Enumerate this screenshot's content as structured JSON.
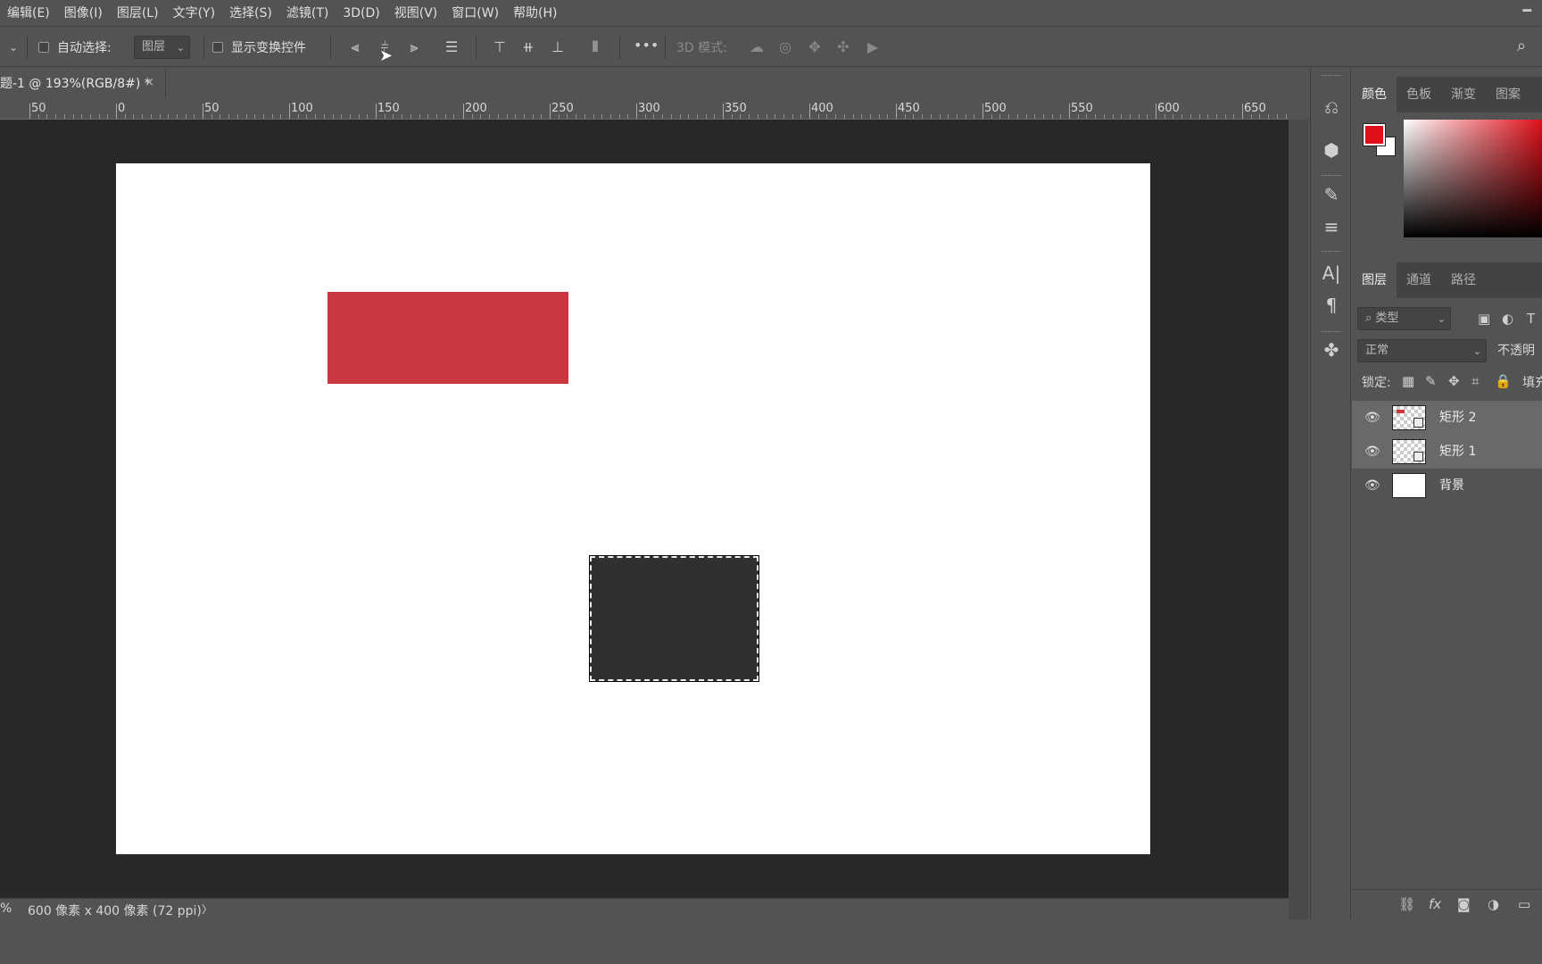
{
  "menubar": {
    "items": [
      "编辑(E)",
      "图像(I)",
      "图层(L)",
      "文字(Y)",
      "选择(S)",
      "滤镜(T)",
      "3D(D)",
      "视图(V)",
      "窗口(W)",
      "帮助(H)"
    ],
    "minimize_icon": "minimize-icon"
  },
  "options": {
    "auto_select_label": "自动选择:",
    "auto_select_checked": false,
    "auto_select_target": "图层",
    "show_transform_label": "显示变换控件",
    "show_transform_checked": false,
    "mode_3d_label": "3D 模式:"
  },
  "document": {
    "tab_title": "题-1 @ 193%(RGB/8#) *",
    "close_glyph": "×"
  },
  "ruler": {
    "labels": [
      "50",
      "0",
      "50",
      "100",
      "150",
      "200",
      "250",
      "300",
      "350",
      "400",
      "450",
      "500",
      "550",
      "600",
      "650"
    ]
  },
  "canvas": {
    "background": "#ffffff",
    "rect1_color": "#c93840",
    "rect2_color": "#303030",
    "rect2_selected": true
  },
  "status": {
    "zoom_fragment": "%",
    "doc_info": "600 像素 x 400 像素 (72 ppi)",
    "arrow": "〉"
  },
  "color_panel": {
    "tabs": [
      "颜色",
      "色板",
      "渐变",
      "图案"
    ],
    "active_tab": "颜色",
    "foreground": "#e0101a",
    "background": "#ffffff"
  },
  "layers_panel": {
    "tabs": [
      "图层",
      "通道",
      "路径"
    ],
    "active_tab": "图层",
    "filter_label": "类型",
    "blend_mode": "正常",
    "opacity_label": "不透明",
    "lock_label": "锁定:",
    "fill_label": "填充",
    "layers": [
      {
        "name": "矩形 2",
        "selected": true
      },
      {
        "name": "矩形 1",
        "selected": true
      },
      {
        "name": "背景",
        "selected": false
      }
    ]
  }
}
